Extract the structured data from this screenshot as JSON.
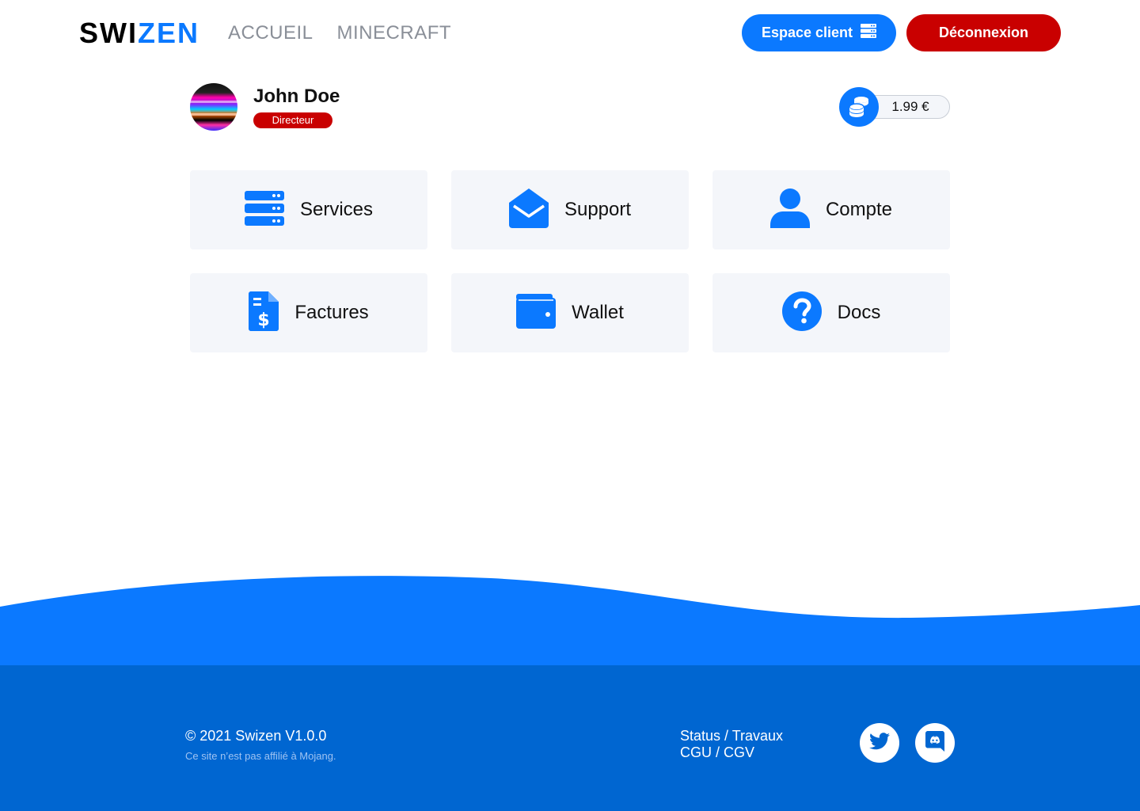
{
  "header": {
    "logo_part1": "SWI",
    "logo_part2": "ZEN",
    "nav": [
      "ACCUEIL",
      "MINECRAFT"
    ],
    "client_button": "Espace client",
    "logout_button": "Déconnexion"
  },
  "profile": {
    "name": "John Doe",
    "role": "Directeur",
    "balance": "1.99 €"
  },
  "cards": [
    {
      "label": "Services",
      "icon": "server-icon"
    },
    {
      "label": "Support",
      "icon": "envelope-open-icon"
    },
    {
      "label": "Compte",
      "icon": "user-icon"
    },
    {
      "label": "Factures",
      "icon": "invoice-dollar-icon"
    },
    {
      "label": "Wallet",
      "icon": "wallet-icon"
    },
    {
      "label": "Docs",
      "icon": "question-circle-icon"
    }
  ],
  "footer": {
    "copyright": "© 2021 Swizen V1.0.0",
    "notice": "Ce site n’est pas affilié à Mojang.",
    "links": [
      "Status / Travaux",
      "CGU / CGV"
    ],
    "social": [
      "twitter-icon",
      "discord-icon"
    ]
  },
  "colors": {
    "accent": "#0b79ff",
    "danger": "#c90000",
    "footer": "#0066d1",
    "card_bg": "#f4f6fa"
  }
}
